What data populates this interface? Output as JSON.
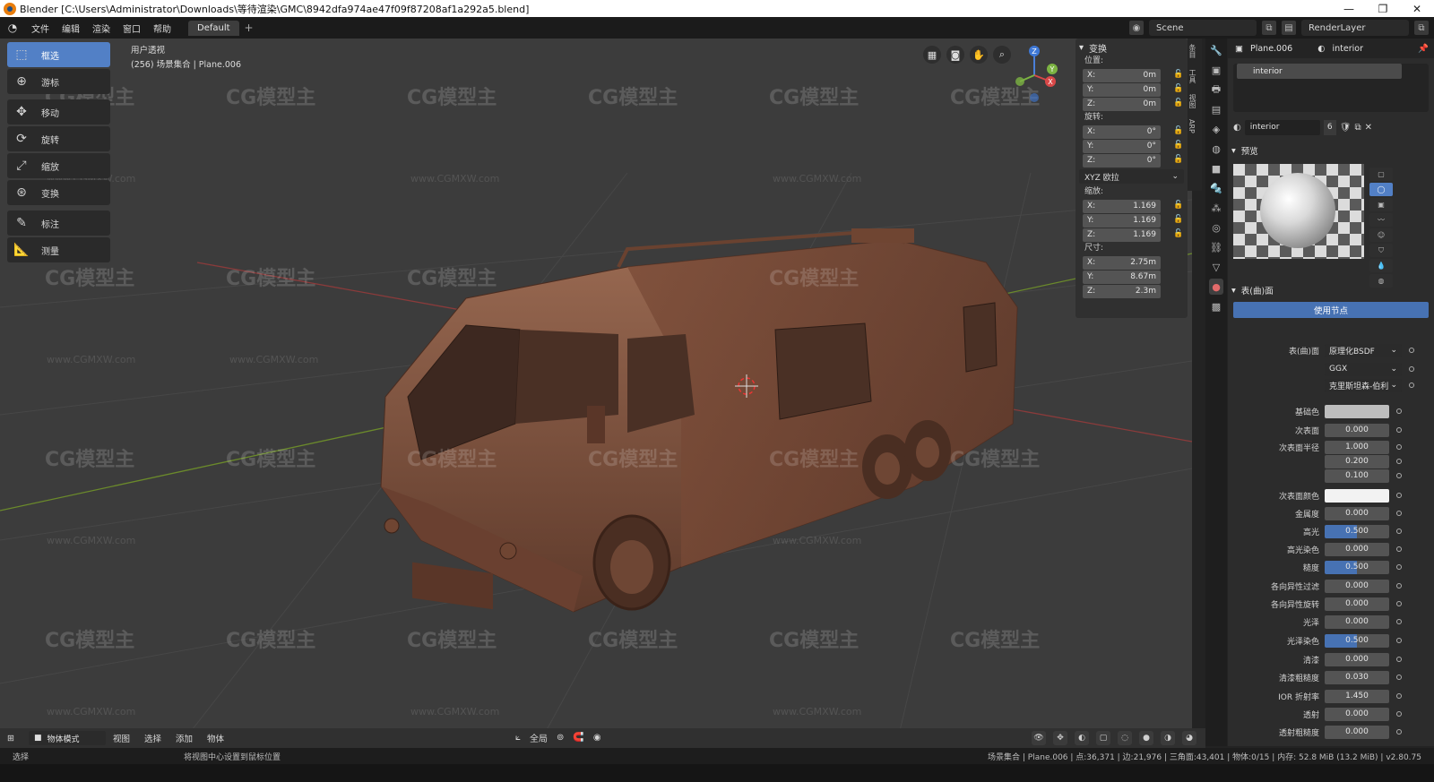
{
  "window": {
    "title": "Blender [C:\\Users\\Administrator\\Downloads\\等待渲染\\GMC\\8942dfa974ae47f09f87208af1a292a5.blend]",
    "minimize": "—",
    "restore": "❐",
    "close": "✕"
  },
  "menu": {
    "items": [
      "文件",
      "编辑",
      "渲染",
      "窗口",
      "帮助"
    ],
    "workspace_tab": "Default",
    "add_tab": "+",
    "scene": "Scene",
    "view_layer": "RenderLayer"
  },
  "viewport": {
    "view_name": "用户透视",
    "collection_info": "(256) 场景集合 | Plane.006",
    "tools": [
      {
        "label": "框选",
        "icon": "select-box-icon"
      },
      {
        "label": "游标",
        "icon": "cursor-icon"
      },
      {
        "label": "移动",
        "icon": "move-icon"
      },
      {
        "label": "旋转",
        "icon": "rotate-icon"
      },
      {
        "label": "缩放",
        "icon": "scale-icon"
      },
      {
        "label": "变换",
        "icon": "transform-icon"
      },
      {
        "label": "标注",
        "icon": "annotate-icon"
      },
      {
        "label": "测量",
        "icon": "measure-icon"
      }
    ],
    "gizmo_axes": {
      "x": "X",
      "y": "Y",
      "z": "Z"
    },
    "watermark": "CG模型主",
    "watermark_url": "www.CGMXW.com"
  },
  "transform_panel": {
    "title": "变换",
    "location_label": "位置:",
    "location": [
      {
        "axis": "X:",
        "value": "0m"
      },
      {
        "axis": "Y:",
        "value": "0m"
      },
      {
        "axis": "Z:",
        "value": "0m"
      }
    ],
    "rotation_label": "旋转:",
    "rotation": [
      {
        "axis": "X:",
        "value": "0°"
      },
      {
        "axis": "Y:",
        "value": "0°"
      },
      {
        "axis": "Z:",
        "value": "0°"
      }
    ],
    "rotation_mode": "XYZ 欧拉",
    "scale_label": "缩放:",
    "scale": [
      {
        "axis": "X:",
        "value": "1.169"
      },
      {
        "axis": "Y:",
        "value": "1.169"
      },
      {
        "axis": "Z:",
        "value": "1.169"
      }
    ],
    "dimensions_label": "尺寸:",
    "dimensions": [
      {
        "axis": "X:",
        "value": "2.75m"
      },
      {
        "axis": "Y:",
        "value": "8.67m"
      },
      {
        "axis": "Z:",
        "value": "2.3m"
      }
    ]
  },
  "side_tabs": [
    "条目",
    "工具",
    "视图",
    "ARP"
  ],
  "properties": {
    "object_name": "Plane.006",
    "material_name": "interior",
    "slot": "interior",
    "mat_field": "interior",
    "users": "6",
    "preview_title": "预览",
    "surface_title": "表(曲)面",
    "use_nodes": "使用节点",
    "rows": [
      {
        "label": "表(曲)面",
        "value": "原理化BSDF",
        "kind": "drop"
      },
      {
        "label": "",
        "value": "GGX",
        "kind": "drop"
      },
      {
        "label": "",
        "value": "克里斯坦森-伯利",
        "kind": "drop"
      },
      {
        "label": "基础色",
        "value": "",
        "kind": "gray"
      },
      {
        "label": "次表面",
        "value": "0.000",
        "kind": "num"
      },
      {
        "label": "次表面半径",
        "value": "1.000",
        "kind": "num"
      },
      {
        "label": "",
        "value": "0.200",
        "kind": "num"
      },
      {
        "label": "",
        "value": "0.100",
        "kind": "num"
      },
      {
        "label": "次表面颜色",
        "value": "",
        "kind": "white"
      },
      {
        "label": "金属度",
        "value": "0.000",
        "kind": "num"
      },
      {
        "label": "高光",
        "value": "0.500",
        "kind": "hl"
      },
      {
        "label": "高光染色",
        "value": "0.000",
        "kind": "num"
      },
      {
        "label": "糙度",
        "value": "0.500",
        "kind": "hl"
      },
      {
        "label": "各向异性过滤",
        "value": "0.000",
        "kind": "num"
      },
      {
        "label": "各向异性旋转",
        "value": "0.000",
        "kind": "num"
      },
      {
        "label": "光泽",
        "value": "0.000",
        "kind": "num"
      },
      {
        "label": "光泽染色",
        "value": "0.500",
        "kind": "hl"
      },
      {
        "label": "清漆",
        "value": "0.000",
        "kind": "num"
      },
      {
        "label": "清漆粗糙度",
        "value": "0.030",
        "kind": "num"
      },
      {
        "label": "IOR 折射率",
        "value": "1.450",
        "kind": "num"
      },
      {
        "label": "透射",
        "value": "0.000",
        "kind": "num"
      },
      {
        "label": "透射粗糙度",
        "value": "0.000",
        "kind": "num"
      }
    ]
  },
  "bottom_header": {
    "mode": "物体模式",
    "menus": [
      "视图",
      "选择",
      "添加",
      "物体"
    ],
    "orientation": "全局"
  },
  "status": {
    "left": "选择",
    "middle": "将视图中心设置到鼠标位置",
    "right": "场景集合 | Plane.006 | 点:36,371 | 边:21,976 | 三角面:43,401 | 物体:0/15 | 内存: 52.8 MiB (13.2 MiB) | v2.80.75"
  },
  "colors": {
    "accent": "#5280c6",
    "viewport_bg": "#3c3c3c",
    "model": "#8a5a43"
  }
}
